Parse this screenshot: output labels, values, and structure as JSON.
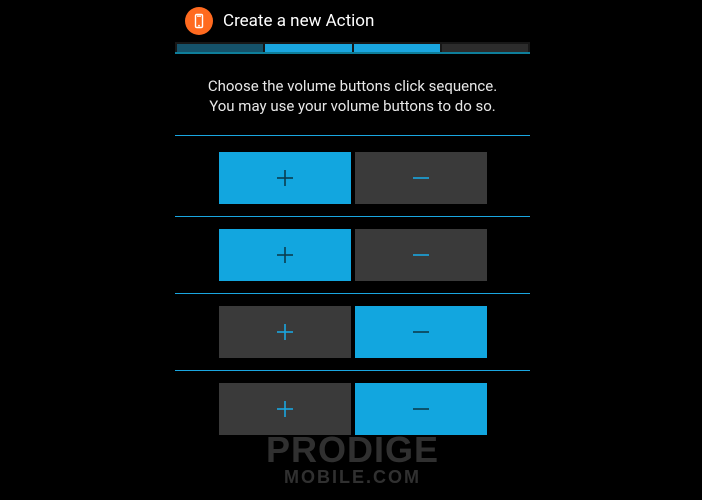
{
  "header": {
    "title": "Create a new Action",
    "icon_name": "app-phone-icon"
  },
  "progress": {
    "steps": [
      "done",
      "active",
      "active",
      "todo"
    ]
  },
  "instruction": {
    "line1": "Choose the volume buttons click sequence.",
    "line2": "You may use your volume buttons to do so."
  },
  "colors": {
    "accent": "#12a6df",
    "accent_line": "#1aa6e0",
    "grey": "#3a3a3a"
  },
  "rows": [
    {
      "plus": "cyan",
      "minus": "grey"
    },
    {
      "plus": "cyan",
      "minus": "grey"
    },
    {
      "plus": "grey",
      "minus": "cyan"
    },
    {
      "plus": "grey",
      "minus": "cyan"
    }
  ],
  "symbols": {
    "plus": "+",
    "minus": "−"
  },
  "watermark": {
    "brand_line1": "PRODIGE",
    "brand_line2": "MOBILE.COM"
  }
}
